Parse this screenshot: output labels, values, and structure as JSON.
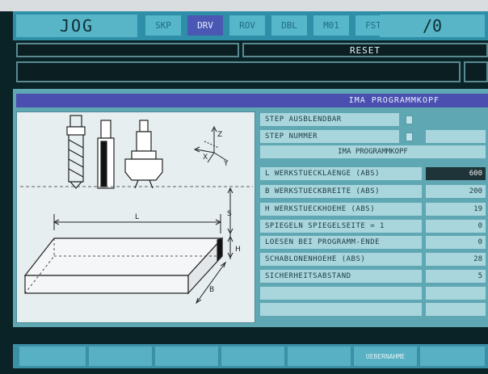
{
  "header": {
    "mode": "JOG",
    "tabs": [
      {
        "label": "SKP",
        "active": false
      },
      {
        "label": "DRV",
        "active": true
      },
      {
        "label": "ROV",
        "active": false
      },
      {
        "label": "DBL",
        "active": false
      },
      {
        "label": "M01",
        "active": false
      },
      {
        "label": "FST",
        "active": false
      }
    ],
    "channel": "/0"
  },
  "status": {
    "reset": "RESET"
  },
  "dialog": {
    "title": "IMA PROGRAMMKOPF",
    "subheader": "IMA PROGRAMMKOPF",
    "checkbox_rows": [
      {
        "label": "STEP AUSBLENDBAR",
        "checked": false
      },
      {
        "label": "STEP NUMMER",
        "checked": false
      }
    ],
    "fields": [
      {
        "label": "L WERKSTUECKLAENGE (ABS)",
        "value": "600",
        "selected": true
      },
      {
        "label": "B WERKSTUECKBREITE (ABS)",
        "value": "200",
        "selected": false
      },
      {
        "label": "H WERKSTUECKHOEHE (ABS)",
        "value": "19",
        "selected": false
      },
      {
        "label": "SPIEGELN SPIEGELSEITE = 1",
        "value": "0",
        "selected": false
      },
      {
        "label": "LOESEN BEI PROGRAMM-ENDE",
        "value": "0",
        "selected": false
      },
      {
        "label": "SCHABLONENHOEHE (ABS)",
        "value": "28",
        "selected": false
      },
      {
        "label": "SICHERHEITSABSTAND",
        "value": "5",
        "selected": false
      },
      {
        "label": "",
        "value": "",
        "selected": false
      },
      {
        "label": "",
        "value": "",
        "selected": false
      }
    ],
    "drawing": {
      "axes": {
        "z": "Z",
        "x": "X",
        "y": "Y"
      },
      "dims": {
        "l": "L",
        "s": "S",
        "h": "H",
        "b": "B"
      }
    }
  },
  "softkeys": [
    "",
    "",
    "",
    "",
    "",
    "UEBERNAHME",
    ""
  ]
}
